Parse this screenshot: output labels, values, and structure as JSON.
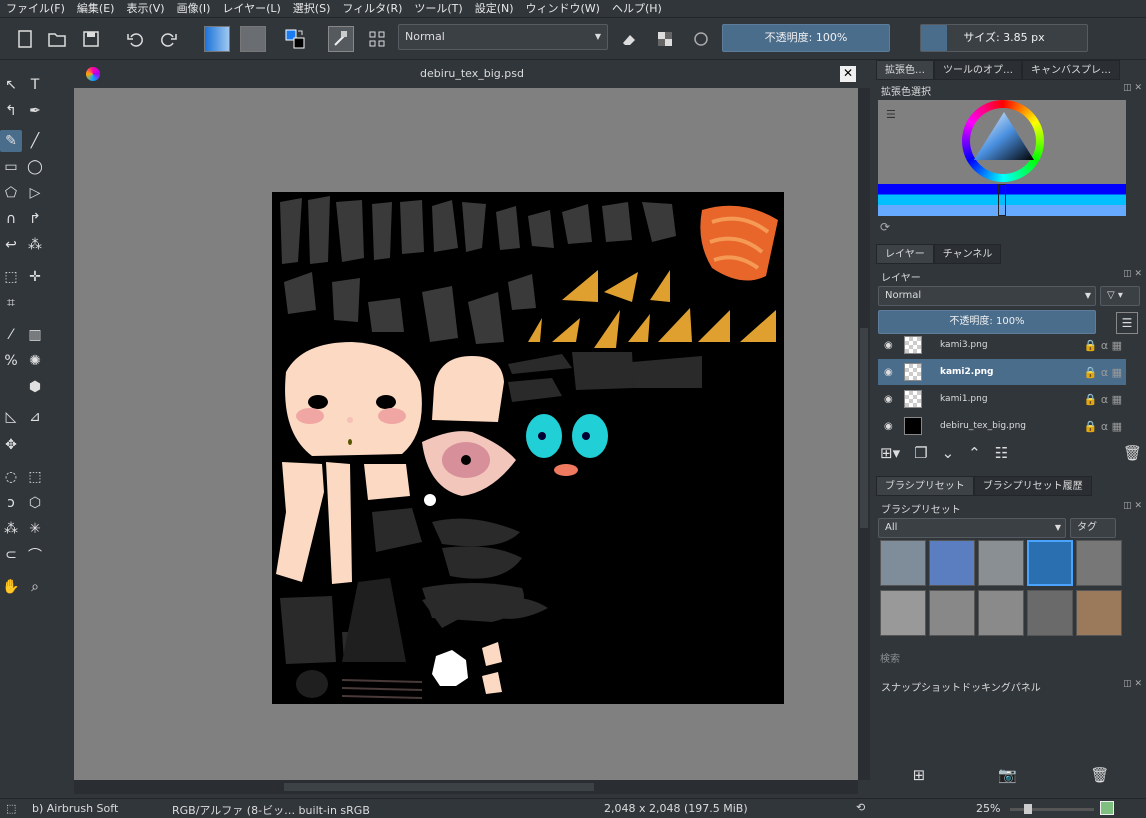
{
  "menu": [
    "ファイル(F)",
    "編集(E)",
    "表示(V)",
    "画像(I)",
    "レイヤー(L)",
    "選択(S)",
    "フィルタ(R)",
    "ツール(T)",
    "設定(N)",
    "ウィンドウ(W)",
    "ヘルプ(H)"
  ],
  "toolbar": {
    "blend_mode": "Normal",
    "opacity_label": "不透明度: 100%",
    "size_label": "サイズ: 3.85 px"
  },
  "document": {
    "title": "debiru_tex_big.psd"
  },
  "right": {
    "top_tabs": [
      "拡張色…",
      "ツールのオプ…",
      "キャンバスプレ…"
    ],
    "color_title": "拡張色選択",
    "layer_tabs": [
      "レイヤー",
      "チャンネル"
    ],
    "layer_title": "レイヤー",
    "layer_blend": "Normal",
    "layer_opacity": "不透明度: 100%",
    "layers": [
      {
        "name": "kami3.png"
      },
      {
        "name": "kami2.png"
      },
      {
        "name": "kami1.png"
      },
      {
        "name": "debiru_tex_big.png"
      }
    ],
    "brush_tabs": [
      "ブラシプリセット",
      "ブラシプリセット履歴"
    ],
    "brush_title": "ブラシプリセット",
    "brush_filter": "All",
    "brush_tag": "タグ",
    "search_placeholder": "検索",
    "snapshot_title": "スナップショットドッキングパネル"
  },
  "status": {
    "brush": "b) Airbrush Soft",
    "color": "RGB/アルファ (8-ビッ… built-in sRGB",
    "dims": "2,048 x 2,048 (197.5 MiB)",
    "zoom": "25%"
  },
  "colors": {
    "accent": "#4a6d8c",
    "bg": "#31363b"
  }
}
